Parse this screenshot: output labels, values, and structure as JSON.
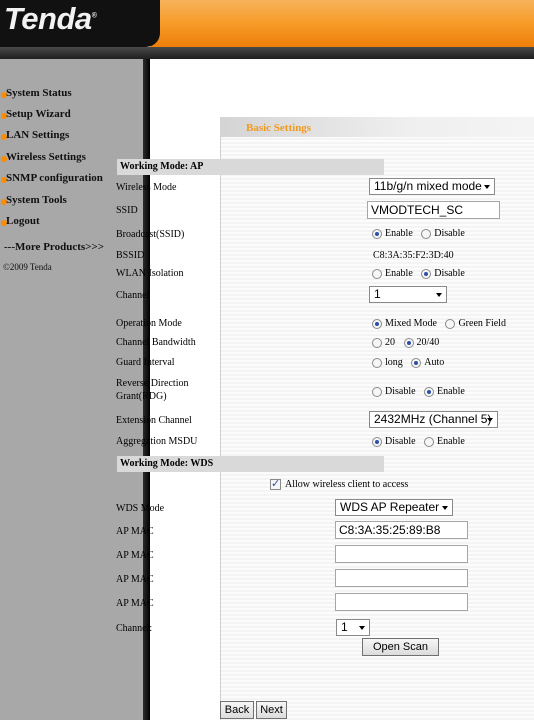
{
  "brand": {
    "logo_text": "Tenda",
    "registered": "®"
  },
  "sidebar": {
    "items": [
      {
        "label": "System Status"
      },
      {
        "label": "Setup Wizard"
      },
      {
        "label": "LAN Settings"
      },
      {
        "label": "Wireless Settings"
      },
      {
        "label": "SNMP configuration"
      },
      {
        "label": "System Tools"
      },
      {
        "label": "Logout"
      }
    ],
    "more_products": "---More Products>>>",
    "copyright": "©2009 Tenda"
  },
  "page": {
    "section_title": "Basic Settings"
  },
  "ap": {
    "heading": "Working Mode: AP",
    "wireless_mode": {
      "label": "Wireless Mode",
      "value": "11b/g/n mixed mode"
    },
    "ssid": {
      "label": "SSID",
      "value": "VMODTECH_SC"
    },
    "broadcast": {
      "label": "Broadcast(SSID)",
      "options": [
        "Enable",
        "Disable"
      ],
      "selected": "Enable"
    },
    "bssid": {
      "label": "BSSID",
      "value": "C8:3A:35:F2:3D:40"
    },
    "wlan_isolation": {
      "label": "WLAN Isolation",
      "options": [
        "Enable",
        "Disable"
      ],
      "selected": "Disable"
    },
    "channel": {
      "label": "Channel",
      "value": "1"
    },
    "operation_mode": {
      "label": "Operation Mode",
      "options": [
        "Mixed Mode",
        "Green Field"
      ],
      "selected": "Mixed Mode"
    },
    "channel_bandwidth": {
      "label": "Channel Bandwidth",
      "options": [
        "20",
        "20/40"
      ],
      "selected": "20/40"
    },
    "guard_interval": {
      "label": "Guard Interval",
      "options": [
        "long",
        "Auto"
      ],
      "selected": "Auto"
    },
    "rdg": {
      "label_line1": "Reverse Direction",
      "label_line2": "Grant(RDG)",
      "options": [
        "Disable",
        "Enable"
      ],
      "selected": "Enable"
    },
    "extension_channel": {
      "label": "Extension Channel",
      "value": "2432MHz (Channel 5)"
    },
    "aggregation_msdu": {
      "label": "Aggregation MSDU",
      "options": [
        "Disable",
        "Enable"
      ],
      "selected": "Disable"
    }
  },
  "wds": {
    "heading": "Working Mode: WDS",
    "allow_wireless": {
      "label": "Allow wireless client to access",
      "checked": true
    },
    "wds_mode": {
      "label": "WDS Mode",
      "value": "WDS AP Repeater"
    },
    "ap_mac_label": "AP MAC",
    "ap_macs": [
      "C8:3A:35:25:89:B8",
      "",
      "",
      ""
    ],
    "channel": {
      "label": "Channel:",
      "value": "1"
    },
    "open_scan": "Open Scan"
  },
  "footer": {
    "back": "Back",
    "next": "Next"
  }
}
